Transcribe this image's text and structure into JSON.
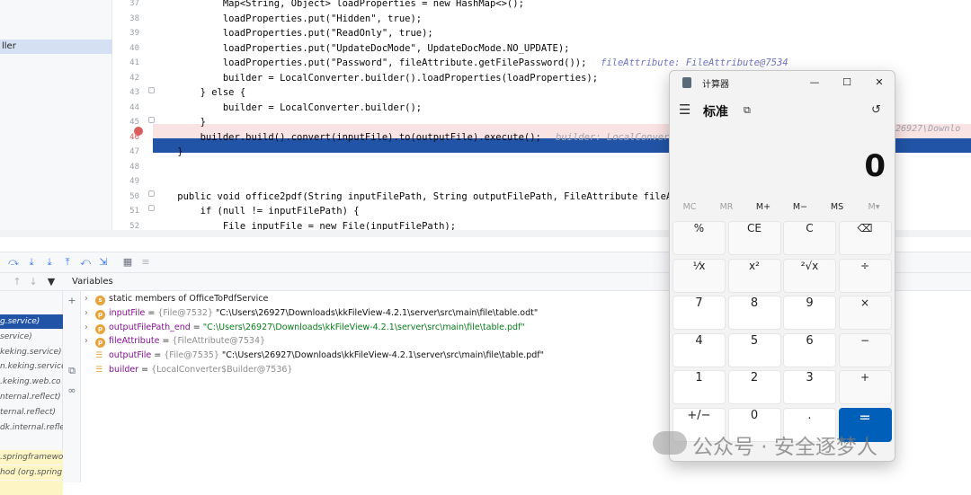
{
  "project_tree": {
    "selected_item": "ller"
  },
  "editor": {
    "lines": [
      {
        "num": "37",
        "code": "            Map<String, Object> loadProperties = new HashMap<>();"
      },
      {
        "num": "38",
        "code": "            loadProperties.put(\"Hidden\", true);"
      },
      {
        "num": "39",
        "code": "            loadProperties.put(\"ReadOnly\", true);"
      },
      {
        "num": "40",
        "code": "            loadProperties.put(\"UpdateDocMode\", UpdateDocMode.NO_UPDATE);"
      },
      {
        "num": "41",
        "code": "            loadProperties.put(\"Password\", fileAttribute.getFilePassword());"
      },
      {
        "num": "42",
        "code": "            builder = LocalConverter.builder().loadProperties(loadProperties);"
      },
      {
        "num": "43",
        "code": "        } else {"
      },
      {
        "num": "44",
        "code": "            builder = LocalConverter.builder();"
      },
      {
        "num": "45",
        "code": "        }"
      },
      {
        "num": "46",
        "code": "        builder.build().convert(inputFile).to(outputFile).execute();"
      },
      {
        "num": "47",
        "code": "    }"
      },
      {
        "num": "48",
        "code": ""
      },
      {
        "num": "49",
        "code": ""
      },
      {
        "num": "50",
        "code": "    public void office2pdf(String inputFilePath, String outputFilePath, FileAttribute fileA"
      },
      {
        "num": "51",
        "code": "        if (null != inputFilePath) {"
      },
      {
        "num": "52",
        "code": "            File inputFile = new File(inputFilePath);"
      }
    ],
    "hint_line41": "fileAttribute: FileAttribute@7534",
    "hint_line46": "builder: LocalConver",
    "hint_right": "s\\26927\\Downlo"
  },
  "variables_panel": {
    "header": "Variables",
    "rows": [
      {
        "icon": "s",
        "name": "static",
        "rest": " members of OfficeToPdfService",
        "type": "",
        "value": ""
      },
      {
        "icon": "p",
        "name": "inputFile",
        "rest": " = ",
        "type": "{File@7532}",
        "value": " \"C:\\Users\\26927\\Downloads\\kkFileView-4.2.1\\server\\src\\main\\file\\table.odt\""
      },
      {
        "icon": "p",
        "name": "outputFilePath_end",
        "rest": " = ",
        "type": "",
        "value": "\"C:\\Users\\26927\\Downloads\\kkFileView-4.2.1\\server\\src\\main\\file\\table.pdf\""
      },
      {
        "icon": "p",
        "name": "fileAttribute",
        "rest": " = ",
        "type": "{FileAttribute@7534}",
        "value": ""
      },
      {
        "icon": "list",
        "name": "outputFile",
        "rest": " = ",
        "type": "{File@7535}",
        "value": " \"C:\\Users\\26927\\Downloads\\kkFileView-4.2.1\\server\\src\\main\\file\\table.pdf\""
      },
      {
        "icon": "list",
        "name": "builder",
        "rest": " = ",
        "type": "{LocalConverter$Builder@7536}",
        "value": ""
      }
    ]
  },
  "frames": [
    {
      "label": "g.service)",
      "state": "selected"
    },
    {
      "label": "service)",
      "state": ""
    },
    {
      "label": "keking.service)",
      "state": ""
    },
    {
      "label": "n.keking.service",
      "state": ""
    },
    {
      "label": ".keking.web.co",
      "state": ""
    },
    {
      "label": "nternal.reflect)",
      "state": ""
    },
    {
      "label": "ternal.reflect)",
      "state": ""
    },
    {
      "label": "dk.internal.refle",
      "state": ""
    },
    {
      "label": "",
      "state": ""
    },
    {
      "label": ".springframewo",
      "state": "yellow"
    },
    {
      "label": "hod (org.spring",
      "state": "yellow"
    },
    {
      "label": "",
      "state": "yellow"
    }
  ],
  "calculator": {
    "title": "计算器",
    "mode": "标准",
    "display": "0",
    "memory": [
      "MC",
      "MR",
      "M+",
      "M−",
      "MS",
      "M▾"
    ],
    "keys": [
      [
        "%",
        "CE",
        "C",
        "⌫"
      ],
      [
        "¹⁄x",
        "x²",
        "²√x",
        "÷"
      ],
      [
        "7",
        "8",
        "9",
        "×"
      ],
      [
        "4",
        "5",
        "6",
        "−"
      ],
      [
        "1",
        "2",
        "3",
        "+"
      ],
      [
        "+/−",
        "0",
        ".",
        "="
      ]
    ]
  },
  "watermark": "公众号 · 安全逐梦人"
}
